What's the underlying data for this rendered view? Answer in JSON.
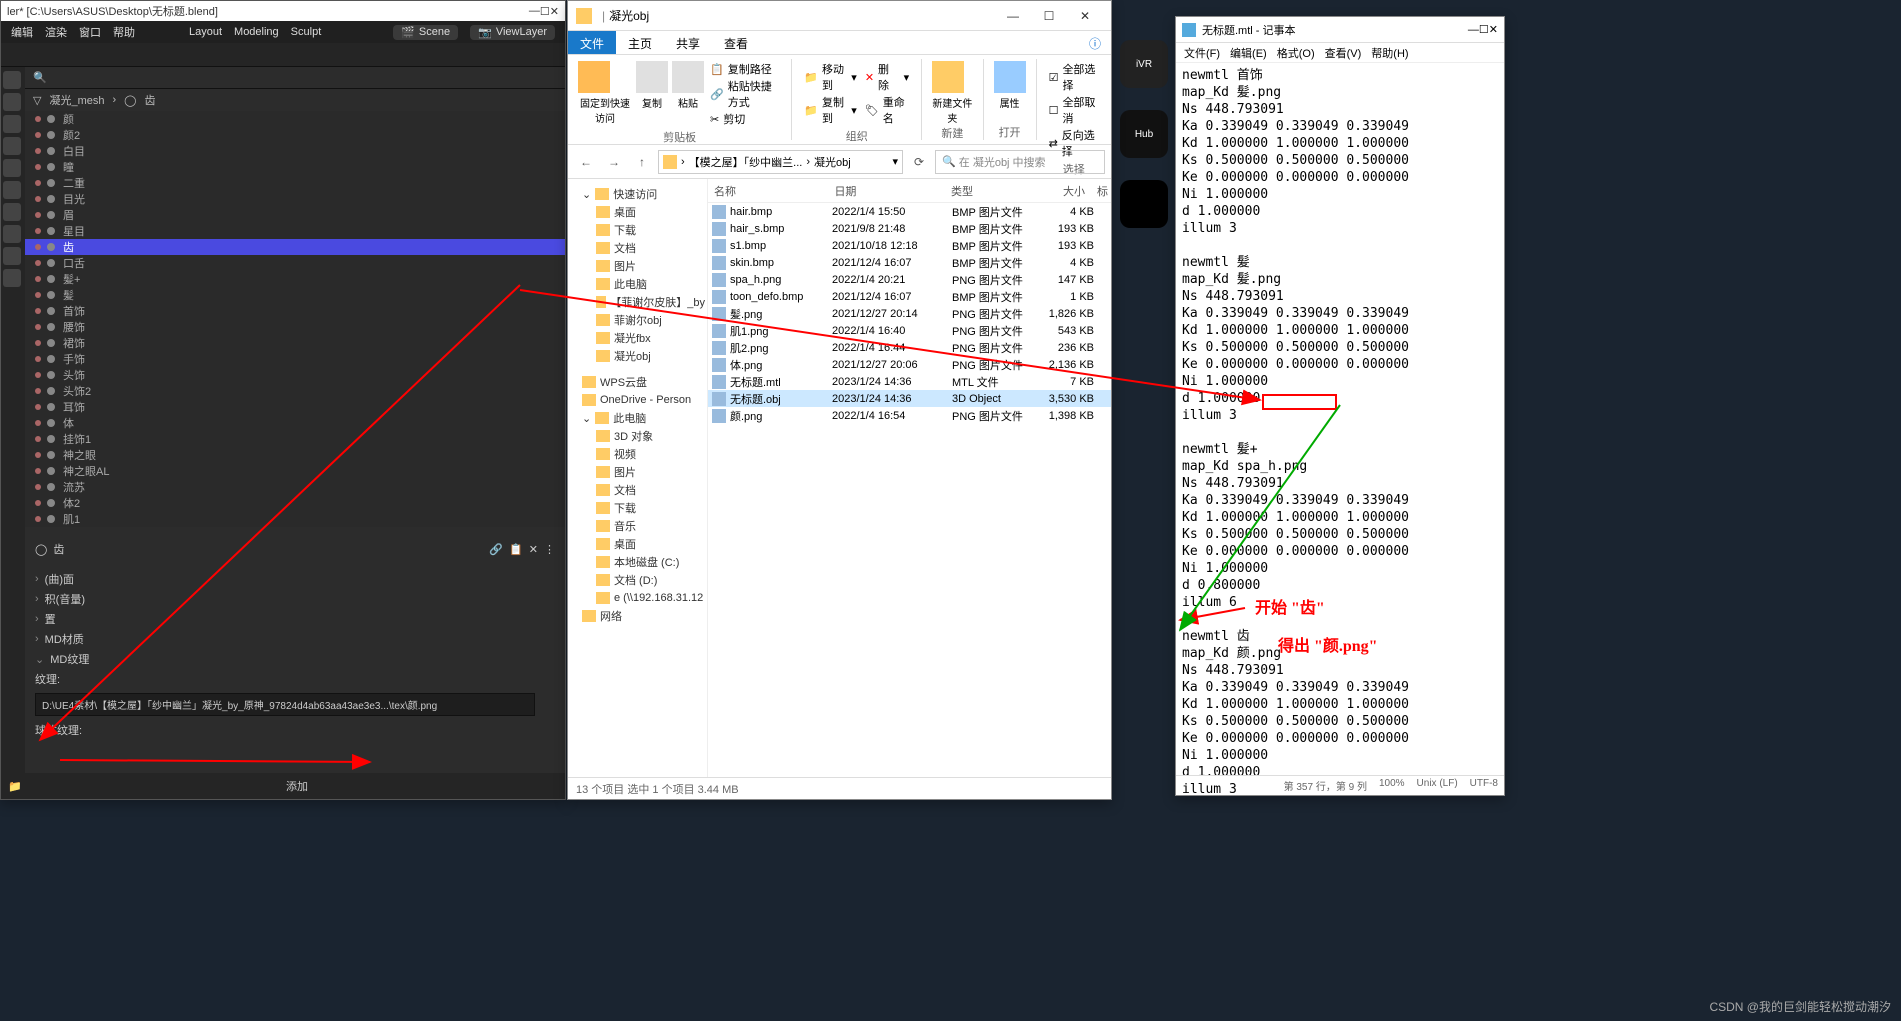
{
  "blender": {
    "title": "ler* [C:\\Users\\ASUS\\Desktop\\无标题.blend]",
    "menu": [
      "编辑",
      "渲染",
      "窗口",
      "帮助"
    ],
    "header_tabs": [
      "Layout",
      "Modeling",
      "Sculpt"
    ],
    "scene_label": "Scene",
    "viewlayer_label": "ViewLayer",
    "breadcrumb": {
      "root": "凝光_mesh",
      "leaf": "齿"
    },
    "outliner": [
      {
        "name": "颜",
        "sel": false
      },
      {
        "name": "颜2",
        "sel": false
      },
      {
        "name": "白目",
        "sel": false
      },
      {
        "name": "瞳",
        "sel": false
      },
      {
        "name": "二重",
        "sel": false
      },
      {
        "name": "目光",
        "sel": false
      },
      {
        "name": "眉",
        "sel": false
      },
      {
        "name": "星目",
        "sel": false
      },
      {
        "name": "齿",
        "sel": true
      },
      {
        "name": "口舌",
        "sel": false
      },
      {
        "name": "髪+",
        "sel": false
      },
      {
        "name": "髪",
        "sel": false
      },
      {
        "name": "首饰",
        "sel": false
      },
      {
        "name": "腰饰",
        "sel": false
      },
      {
        "name": "裙饰",
        "sel": false
      },
      {
        "name": "手饰",
        "sel": false
      },
      {
        "name": "头饰",
        "sel": false
      },
      {
        "name": "头饰2",
        "sel": false
      },
      {
        "name": "耳饰",
        "sel": false
      },
      {
        "name": "体",
        "sel": false
      },
      {
        "name": "挂饰1",
        "sel": false
      },
      {
        "name": "神之眼",
        "sel": false
      },
      {
        "name": "神之眼AL",
        "sel": false
      },
      {
        "name": "流苏",
        "sel": false
      },
      {
        "name": "体2",
        "sel": false
      },
      {
        "name": "肌1",
        "sel": false
      }
    ],
    "props_header": "齿",
    "props": [
      "(曲)面",
      "积(音量)",
      "置",
      "MD材质",
      "MD纹理"
    ],
    "tex_label": "纹理:",
    "tex_path": "D:\\UE4素材\\【模之屋】「纱中幽兰」凝光_by_原神_97824d4ab63aa43ae3e3...\\tex\\颜.png",
    "sphere_label": "球体纹理:",
    "add_btn": "添加"
  },
  "explorer": {
    "title": "凝光obj",
    "tabs": [
      "文件",
      "主页",
      "共享",
      "查看"
    ],
    "ribbon_groups": {
      "clipboard": {
        "pin": "固定到快速访问",
        "copy": "复制",
        "paste": "粘贴",
        "copypath": "复制路径",
        "pasteshortcut": "粘贴快捷方式",
        "cut": "剪切",
        "label": "剪贴板"
      },
      "organize": {
        "moveto": "移动到",
        "copyto": "复制到",
        "delete": "删除",
        "rename": "重命名",
        "label": "组织"
      },
      "new": {
        "newfolder": "新建文件夹",
        "label": "新建"
      },
      "open": {
        "props": "属性",
        "label": "打开"
      },
      "select": {
        "all": "全部选择",
        "none": "全部取消",
        "invert": "反向选择",
        "label": "选择"
      }
    },
    "path_segments": [
      "【模之屋】「纱中幽兰...",
      "凝光obj"
    ],
    "search_placeholder": "在 凝光obj 中搜索",
    "tree": [
      {
        "l": 1,
        "txt": "快速访问",
        "exp": true
      },
      {
        "l": 2,
        "txt": "桌面"
      },
      {
        "l": 2,
        "txt": "下载"
      },
      {
        "l": 2,
        "txt": "文档"
      },
      {
        "l": 2,
        "txt": "图片"
      },
      {
        "l": 2,
        "txt": "此电脑"
      },
      {
        "l": 2,
        "txt": "【菲谢尔皮肤】_by"
      },
      {
        "l": 2,
        "txt": "菲谢尔obj"
      },
      {
        "l": 2,
        "txt": "凝光fbx"
      },
      {
        "l": 2,
        "txt": "凝光obj"
      },
      {
        "l": 1,
        "txt": "WPS云盘"
      },
      {
        "l": 1,
        "txt": "OneDrive - Person"
      },
      {
        "l": 1,
        "txt": "此电脑",
        "exp": true
      },
      {
        "l": 2,
        "txt": "3D 对象"
      },
      {
        "l": 2,
        "txt": "视频"
      },
      {
        "l": 2,
        "txt": "图片"
      },
      {
        "l": 2,
        "txt": "文档"
      },
      {
        "l": 2,
        "txt": "下载"
      },
      {
        "l": 2,
        "txt": "音乐"
      },
      {
        "l": 2,
        "txt": "桌面"
      },
      {
        "l": 2,
        "txt": "本地磁盘 (C:)"
      },
      {
        "l": 2,
        "txt": "文档 (D:)"
      },
      {
        "l": 2,
        "txt": "e (\\\\192.168.31.12"
      },
      {
        "l": 1,
        "txt": "网络"
      }
    ],
    "columns": {
      "name": "名称",
      "date": "日期",
      "type": "类型",
      "size": "大小",
      "tag": "标"
    },
    "files": [
      {
        "name": "hair.bmp",
        "date": "2022/1/4 15:50",
        "type": "BMP 图片文件",
        "size": "4 KB"
      },
      {
        "name": "hair_s.bmp",
        "date": "2021/9/8 21:48",
        "type": "BMP 图片文件",
        "size": "193 KB"
      },
      {
        "name": "s1.bmp",
        "date": "2021/10/18 12:18",
        "type": "BMP 图片文件",
        "size": "193 KB"
      },
      {
        "name": "skin.bmp",
        "date": "2021/12/4 16:07",
        "type": "BMP 图片文件",
        "size": "4 KB"
      },
      {
        "name": "spa_h.png",
        "date": "2022/1/4 20:21",
        "type": "PNG 图片文件",
        "size": "147 KB"
      },
      {
        "name": "toon_defo.bmp",
        "date": "2021/12/4 16:07",
        "type": "BMP 图片文件",
        "size": "1 KB"
      },
      {
        "name": "髪.png",
        "date": "2021/12/27 20:14",
        "type": "PNG 图片文件",
        "size": "1,826 KB"
      },
      {
        "name": "肌1.png",
        "date": "2022/1/4 16:40",
        "type": "PNG 图片文件",
        "size": "543 KB"
      },
      {
        "name": "肌2.png",
        "date": "2022/1/4 16:44",
        "type": "PNG 图片文件",
        "size": "236 KB"
      },
      {
        "name": "体.png",
        "date": "2021/12/27 20:06",
        "type": "PNG 图片文件",
        "size": "2,136 KB"
      },
      {
        "name": "无标题.mtl",
        "date": "2023/1/24 14:36",
        "type": "MTL 文件",
        "size": "7 KB"
      },
      {
        "name": "无标题.obj",
        "date": "2023/1/24 14:36",
        "type": "3D Object",
        "size": "3,530 KB",
        "sel": true
      },
      {
        "name": "颜.png",
        "date": "2022/1/4 16:54",
        "type": "PNG 图片文件",
        "size": "1,398 KB",
        "box": true
      }
    ],
    "status": "13 个项目    选中 1 个项目  3.44 MB"
  },
  "notepad": {
    "title": "无标题.mtl - 记事本",
    "menu": [
      "文件(F)",
      "编辑(E)",
      "格式(O)",
      "查看(V)",
      "帮助(H)"
    ],
    "content": "newmtl 首饰\nmap_Kd 髪.png\nNs 448.793091\nKa 0.339049 0.339049 0.339049\nKd 1.000000 1.000000 1.000000\nKs 0.500000 0.500000 0.500000\nKe 0.000000 0.000000 0.000000\nNi 1.000000\nd 1.000000\nillum 3\n\nnewmtl 髪\nmap_Kd 髪.png\nNs 448.793091\nKa 0.339049 0.339049 0.339049\nKd 1.000000 1.000000 1.000000\nKs 0.500000 0.500000 0.500000\nKe 0.000000 0.000000 0.000000\nNi 1.000000\nd 1.000000\nillum 3\n\nnewmtl 髪+\nmap_Kd spa_h.png\nNs 448.793091\nKa 0.339049 0.339049 0.339049\nKd 1.000000 1.000000 1.000000\nKs 0.500000 0.500000 0.500000\nKe 0.000000 0.000000 0.000000\nNi 1.000000\nd 0.800000\nillum 6\n\nnewmtl 齿\nmap_Kd 颜.png\nNs 448.793091\nKa 0.339049 0.339049 0.339049\nKd 1.000000 1.000000 1.000000\nKs 0.500000 0.500000 0.500000\nKe 0.000000 0.000000 0.000000\nNi 1.000000\nd 1.000000\nillum 3",
    "status": {
      "pos": "第 357 行，第 9 列",
      "zoom": "100%",
      "eol": "Unix (LF)",
      "enc": "UTF-8"
    }
  },
  "annotations": {
    "a1": "开始 \"齿\"",
    "a2": "得出 \"颜.png\""
  },
  "watermark": "CSDN @我的巨剑能轻松搅动潮汐",
  "bgicons": {
    "hub": "Hub",
    "vr": "iVR"
  }
}
